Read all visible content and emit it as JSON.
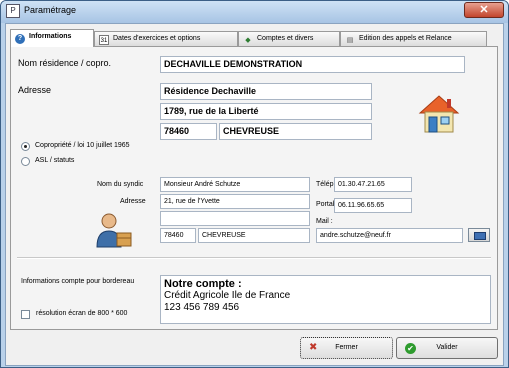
{
  "window": {
    "title": "Paramétrage",
    "close_glyph": "✕",
    "app_icon_glyph": "P"
  },
  "tabs": [
    {
      "label": "Informations",
      "icon": "info-icon",
      "glyph": "?",
      "active": true
    },
    {
      "label": "Dates d'exercices et options",
      "icon": "calendar-icon",
      "glyph": "31",
      "active": false
    },
    {
      "label": "Comptes et divers",
      "icon": "accounts-icon",
      "glyph": "◆",
      "active": false
    },
    {
      "label": "Edition des appels et Relance",
      "icon": "printer-icon",
      "glyph": "▤",
      "active": false
    }
  ],
  "residence": {
    "name_label": "Nom résidence / copro.",
    "name_value": "DECHAVILLE DEMONSTRATION",
    "address_label": "Adresse",
    "address_line1": "Résidence Dechaville",
    "address_line2": "1789, rue de la Liberté",
    "postal_code": "78460",
    "city": "CHEVREUSE"
  },
  "status_options": [
    {
      "label": "Copropriété / loi 10 juillet 1965",
      "selected": true
    },
    {
      "label": "ASL / statuts",
      "selected": false
    }
  ],
  "syndic": {
    "name_label": "Nom du syndic",
    "name_value": "Monsieur André Schutze",
    "address_label": "Adresse",
    "address_line1": "21, rue de l'Yvette",
    "address_line2": "",
    "postal_code": "78460",
    "city": "CHEVREUSE",
    "phone_label": "Téléphone :",
    "phone_value": "01.30.47.21.65",
    "mobile_label": "Portable :",
    "mobile_value": "06.11.96.65.65",
    "mail_label": "Mail :",
    "mail_value": "andre.schutze@neuf.fr"
  },
  "bordereau": {
    "label": "Informations compte pour bordereau",
    "title_line": "Notre compte :",
    "line2": "Crédit Agricole Ile de France",
    "line3": "123 456 789 456"
  },
  "resolution": {
    "label": "résolution écran de 800 * 600",
    "checked": false
  },
  "buttons": {
    "close_label": "Fermer",
    "close_glyph": "✖",
    "validate_label": "Valider",
    "validate_glyph": "✔"
  },
  "colors": {
    "accent_red": "#c0392b",
    "accent_green": "#2e9b2e",
    "window_frame": "#b9d1ea"
  }
}
